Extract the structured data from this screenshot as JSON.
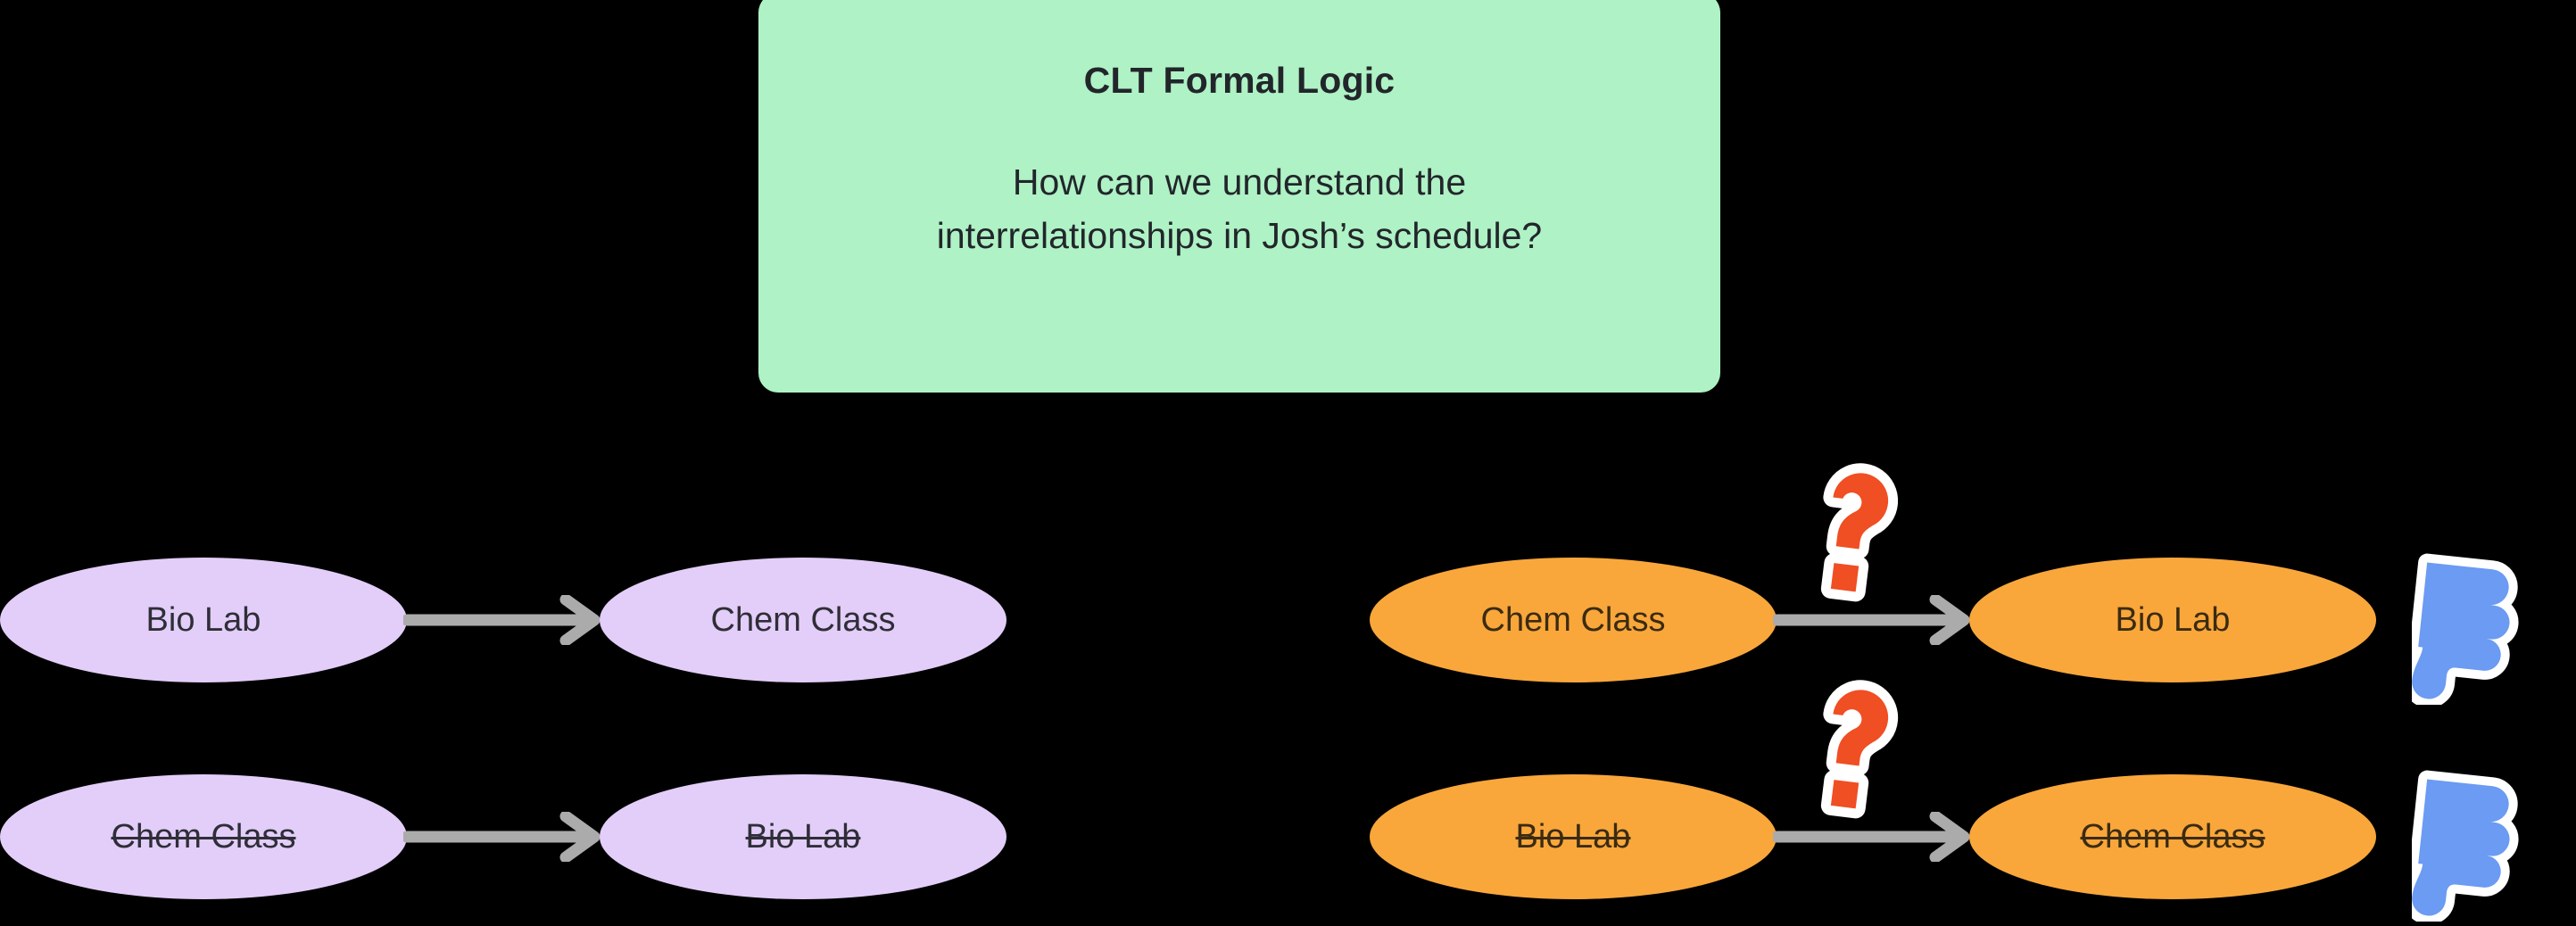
{
  "callout": {
    "title": "CLT Formal Logic",
    "body_line_1": "How can we understand the",
    "body_line_2": "interrelationships in Josh’s schedule?",
    "background_color": "#AFF2C5",
    "text_color": "#22262B"
  },
  "palette": {
    "background": "#000000",
    "purple_node": "#E2CEF8",
    "purple_node_text": "#2F2E38",
    "orange_node": "#F9A73B",
    "orange_node_text": "#3B2B11",
    "arrow": "#ABABAB",
    "question_mark": "#F04E23",
    "thumbs_down": "#6B9BF2",
    "sticker_outline": "#FFFFFF"
  },
  "rows": [
    {
      "group": "left",
      "index": 1,
      "node_color": "purple",
      "source_label": "Bio Lab",
      "target_label": "Chem Class",
      "source_struck": false,
      "target_struck": false,
      "has_question_mark": false,
      "has_thumbs_down": false
    },
    {
      "group": "left",
      "index": 2,
      "node_color": "purple",
      "source_label": "Chem Class",
      "target_label": "Bio Lab",
      "source_struck": true,
      "target_struck": true,
      "has_question_mark": false,
      "has_thumbs_down": false
    },
    {
      "group": "right",
      "index": 1,
      "node_color": "orange",
      "source_label": "Chem Class",
      "target_label": "Bio Lab",
      "source_struck": false,
      "target_struck": false,
      "has_question_mark": true,
      "has_thumbs_down": true
    },
    {
      "group": "right",
      "index": 2,
      "node_color": "orange",
      "source_label": "Bio Lab",
      "target_label": "Chem Class",
      "source_struck": true,
      "target_struck": true,
      "has_question_mark": true,
      "has_thumbs_down": true
    }
  ],
  "icons": {
    "arrow": "arrow-right-icon",
    "question": "question-mark-icon",
    "thumbs_down": "thumbs-down-icon"
  }
}
